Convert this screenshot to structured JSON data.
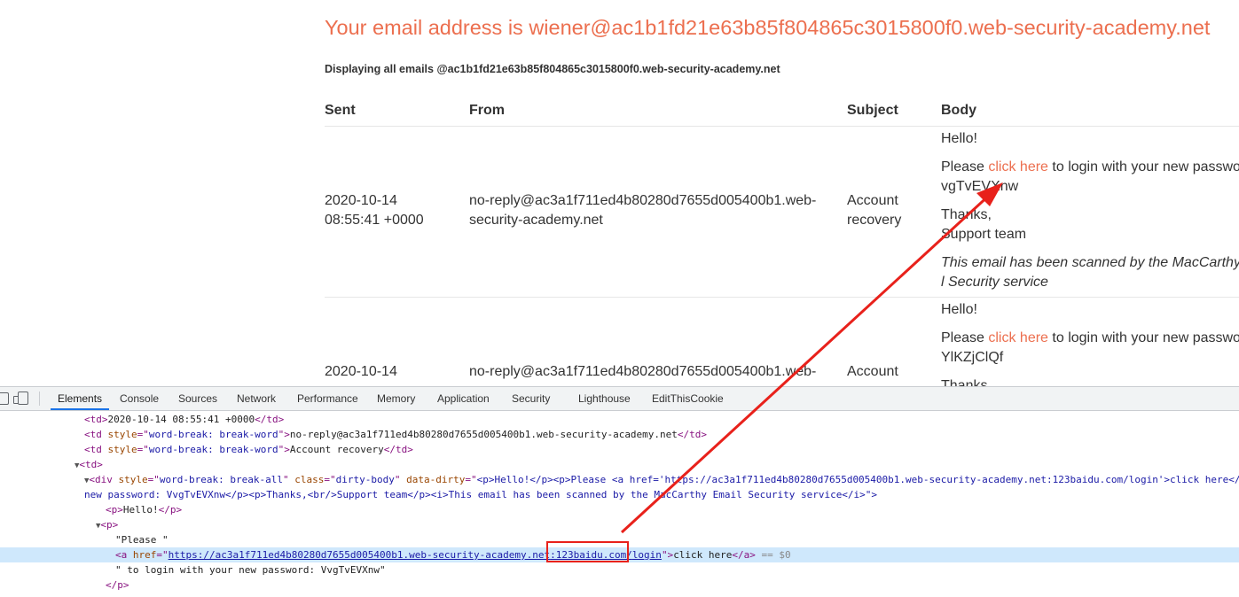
{
  "email_page": {
    "heading": "Your email address is wiener@ac1b1fd21e63b85f804865c3015800f0.web-security-academy.net",
    "subheading": "Displaying all emails @ac1b1fd21e63b85f804865c3015800f0.web-security-academy.net",
    "columns": [
      "Sent",
      "From",
      "Subject",
      "Body"
    ],
    "rows": [
      {
        "sent_date": "2020-10-14",
        "sent_time": "08:55:41 +0000",
        "from_line1": "no-reply@ac3a1f711ed4b80280d7655d005400b1.web-",
        "from_line2": "security-academy.net",
        "subject_line1": "Account",
        "subject_line2": "recovery",
        "greeting": "Hello!",
        "please": "Please ",
        "link": "click here",
        "after_link": " to login with your new passwo",
        "password": "vgTvEVXnw",
        "thanks": "Thanks,",
        "team": "Support team",
        "scanned_line1": "This email has been scanned by the MacCarthy",
        "scanned_line2": "l Security service"
      },
      {
        "sent_date": "2020-10-14",
        "from_line1": "no-reply@ac3a1f711ed4b80280d7655d005400b1.web-",
        "subject_line1": "Account",
        "greeting": "Hello!",
        "please": "Please ",
        "link": "click here",
        "after_link": " to login with your new passwo",
        "password": "YlKZjClQf",
        "thanks": "Thanks"
      }
    ]
  },
  "devtools": {
    "tabs": [
      "Elements",
      "Console",
      "Sources",
      "Network",
      "Performance",
      "Memory",
      "Application",
      "Security",
      "Lighthouse",
      "EditThisCookie"
    ],
    "active_tab": "Elements",
    "dom": {
      "td_sent": "2020-10-14 08:55:41 +0000",
      "td_style": "word-break: break-word",
      "td_from": "no-reply@ac3a1f711ed4b80280d7655d005400b1.web-security-academy.net",
      "td_subject": "Account recovery",
      "div_style": "word-break: break-all",
      "div_class": "dirty-body",
      "div_dirty_a": "<p>Hello!</p><p>Please <a href='https://ac3a1f711ed4b80280d7655d005400b1.web-security-academy.net:123baidu.com/login'>click here</",
      "div_dirty_b": "new password: VvgTvEVXnw</p><p>Thanks,<br/>Support team</p><i>This email has been scanned by the MacCarthy Email Security service</i>\">",
      "p_hello": "Hello!",
      "please_text": "\"Please \"",
      "href_a": "https://ac3a1f711ed4b80280d7655d005400b1.web-security-academy.net",
      "href_b": ":123baidu.com/",
      "href_c": "login",
      "a_text": "click here",
      "dollar": "== $0",
      "after_text": "\" to login with your new password: VvgTvEVXnw\""
    }
  },
  "colors": {
    "accent": "#ec6f4f",
    "annotation": "#e8211b",
    "selected_row": "#cfe8fc"
  }
}
